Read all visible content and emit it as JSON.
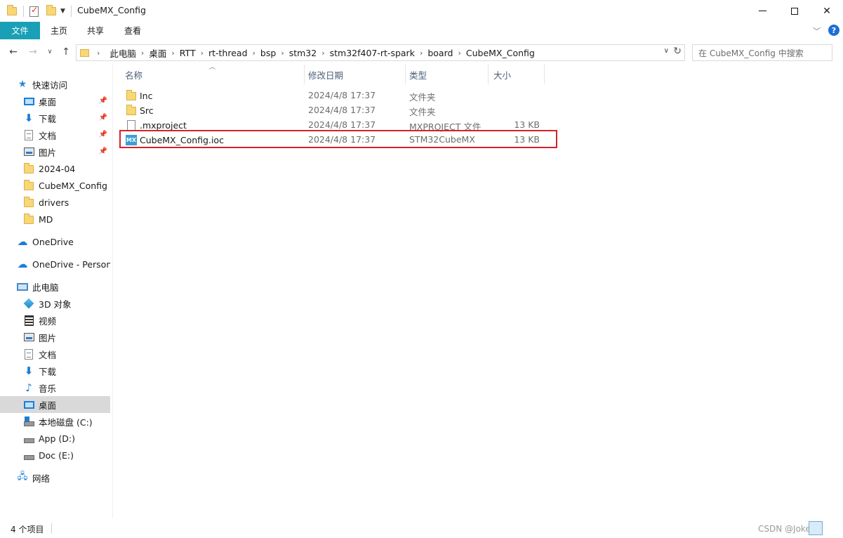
{
  "window": {
    "title": "CubeMX_Config"
  },
  "ribbon": {
    "tabs": [
      "文件",
      "主页",
      "共享",
      "查看"
    ],
    "help": "?"
  },
  "address": {
    "crumbs": [
      "此电脑",
      "桌面",
      "RTT",
      "rt-thread",
      "bsp",
      "stm32",
      "stm32f407-rt-spark",
      "board",
      "CubeMX_Config"
    ]
  },
  "search": {
    "placeholder": "在 CubeMX_Config 中搜索"
  },
  "nav": {
    "items": [
      {
        "label": "快速访问",
        "icon": "star-icon"
      },
      {
        "label": "桌面",
        "icon": "desktop-icon",
        "pinned": true
      },
      {
        "label": "下载",
        "icon": "download-icon",
        "pinned": true
      },
      {
        "label": "文档",
        "icon": "document-icon",
        "pinned": true
      },
      {
        "label": "图片",
        "icon": "pictures-icon",
        "pinned": true
      },
      {
        "label": "2024-04",
        "icon": "folder-icon"
      },
      {
        "label": "CubeMX_Config",
        "icon": "folder-icon"
      },
      {
        "label": "drivers",
        "icon": "folder-icon"
      },
      {
        "label": "MD",
        "icon": "folder-icon"
      },
      {
        "label": "OneDrive",
        "icon": "cloud-icon"
      },
      {
        "label": "OneDrive - Personal",
        "icon": "cloud-icon"
      },
      {
        "label": "此电脑",
        "icon": "computer-icon"
      },
      {
        "label": "3D 对象",
        "icon": "3d-objects-icon"
      },
      {
        "label": "视频",
        "icon": "video-icon"
      },
      {
        "label": "图片",
        "icon": "pictures-icon"
      },
      {
        "label": "文档",
        "icon": "document-icon"
      },
      {
        "label": "下载",
        "icon": "download-icon"
      },
      {
        "label": "音乐",
        "icon": "music-icon"
      },
      {
        "label": "桌面",
        "icon": "desktop-icon",
        "selected": true
      },
      {
        "label": "本地磁盘 (C:)",
        "icon": "drive-c-icon"
      },
      {
        "label": "App (D:)",
        "icon": "drive-icon"
      },
      {
        "label": "Doc (E:)",
        "icon": "drive-icon"
      },
      {
        "label": "网络",
        "icon": "network-icon"
      }
    ]
  },
  "columns": {
    "name": "名称",
    "date": "修改日期",
    "type": "类型",
    "size": "大小"
  },
  "files": [
    {
      "name": "Inc",
      "date": "2024/4/8 17:37",
      "type": "文件夹",
      "size": "",
      "icon": "folder-icon"
    },
    {
      "name": "Src",
      "date": "2024/4/8 17:37",
      "type": "文件夹",
      "size": "",
      "icon": "folder-icon"
    },
    {
      "name": ".mxproject",
      "date": "2024/4/8 17:37",
      "type": "MXPROJECT 文件",
      "size": "13 KB",
      "icon": "file-icon"
    },
    {
      "name": "CubeMX_Config.ioc",
      "date": "2024/4/8 17:37",
      "type": "STM32CubeMX",
      "size": "13 KB",
      "icon": "mx-icon"
    }
  ],
  "mx_badge": "MX",
  "status": {
    "count": "4 个项目",
    "watermark": "CSDN @Joker纪"
  },
  "colors": {
    "file_tab": "#19a0b6",
    "highlight": "#d3242a",
    "selected_nav": "#d9d9d9"
  }
}
